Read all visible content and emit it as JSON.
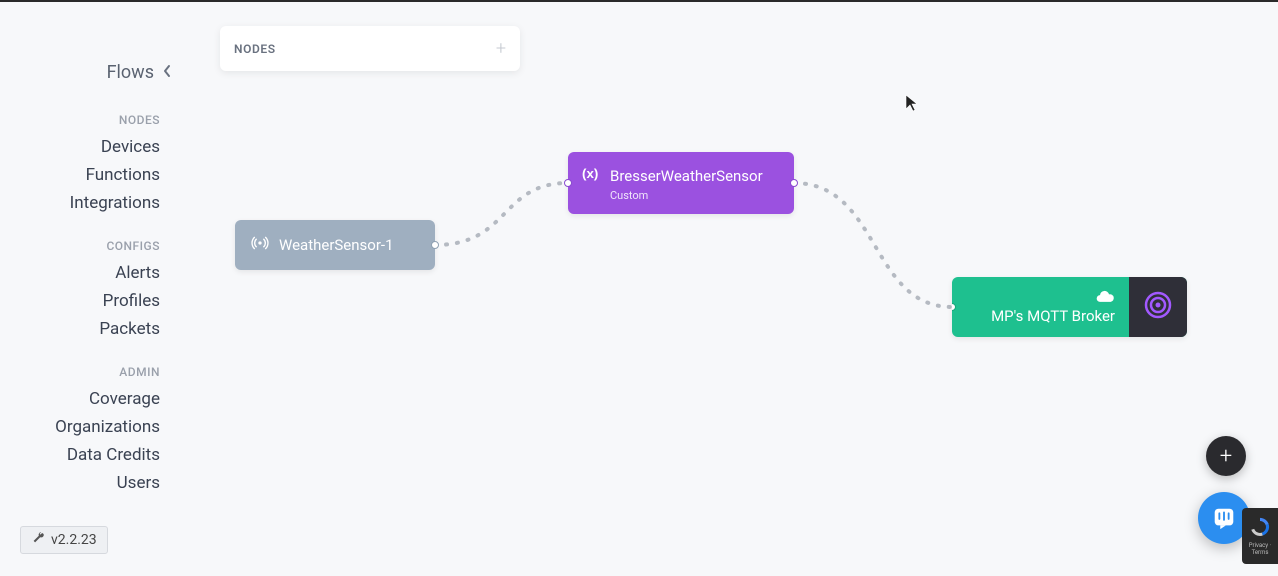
{
  "sidebar": {
    "top_label": "Flows",
    "sections": [
      {
        "header": "NODES",
        "items": [
          "Devices",
          "Functions",
          "Integrations"
        ]
      },
      {
        "header": "CONFIGS",
        "items": [
          "Alerts",
          "Profiles",
          "Packets"
        ]
      },
      {
        "header": "ADMIN",
        "items": [
          "Coverage",
          "Organizations",
          "Data Credits",
          "Users"
        ]
      }
    ]
  },
  "version": "v2.2.23",
  "panel": {
    "title": "NODES"
  },
  "nodes": {
    "device": {
      "label": "WeatherSensor-1",
      "icon": "broadcast-icon"
    },
    "function": {
      "label": "BresserWeatherSensor",
      "subtype": "Custom",
      "icon": "variable-icon"
    },
    "integration": {
      "label": "MP's MQTT Broker",
      "icon": "cloud-icon",
      "badge_icon": "target-icon"
    }
  },
  "colors": {
    "device": "#9fafc0",
    "function": "#9b51e0",
    "integration": "#1ec08f",
    "badge": "#2f2f38",
    "accent_purple": "#a259ff",
    "intercom": "#2b8ef0"
  },
  "recaptcha": {
    "line1": "Privacy · Terms"
  }
}
